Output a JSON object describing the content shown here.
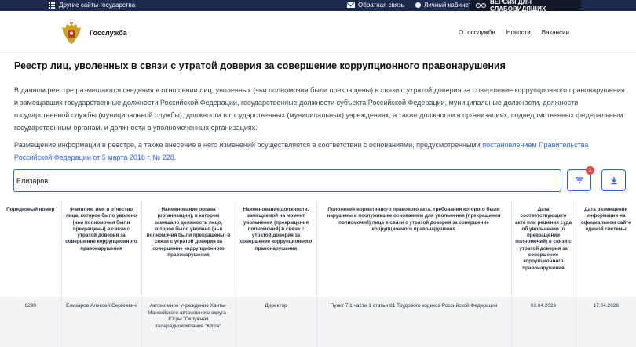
{
  "topbar": {
    "other_sites": "Другие сайты государства",
    "feedback": "Обратная связь",
    "cabinet": "Личный кабинет",
    "vision": "ВЕРСИЯ ДЛЯ СЛАБОВИДЯЩИХ"
  },
  "header": {
    "brand": "Госслужба",
    "nav": [
      "О госслужбе",
      "Новости",
      "Вакансии"
    ]
  },
  "page": {
    "title": "Реестр лиц, уволенных в связи с утратой доверия за совершение коррупционного правонарушения",
    "paragraph1": "В данном реестре размещаются сведения в отношении лиц, уволенных (чьи полномочия были прекращены) в связи с утратой доверия за совершение коррупционного правонарушения и замещавших государственные должности Российской Федерации, государственные должности субъекта Российской Федерации, муниципальные должности, должности государственной службы (муниципальной службы), должности в государственных (муниципальных) учреждениях, а также должности в организациях, подведомственных федеральным государственным органам, и должности в уполномоченных организациях.",
    "paragraph2_text": "Размещение информации в реестре, а также внесение в него изменений осуществляется в соответствии с основаниями, предусмотренными ",
    "paragraph2_link": "постановлением Правительства Российской Федерации от 5 марта 2018 г. № 228",
    "paragraph2_end": "."
  },
  "search": {
    "value": "Елизаров",
    "filter_badge": "1"
  },
  "table": {
    "headers": [
      "Порядковый номер",
      "Фамилия, имя и отчество лица, которое было уволено (чьи полномочия были прекращены) в связи с утратой доверия за совершение коррупционного правонарушения",
      "Наименование органа (организации), в котором замещало должность лицо, которое было уволено (чьи полномочия были прекращены) в связи с утратой доверия за совершение коррупционного правонарушения",
      "Наименование должности, замещаемой на момент увольнения (прекращения полномочий) в связи с утратой доверия за совершение коррупционного правонарушения",
      "Положение нормативного правового акта, требования которого были нарушены и послужившее основанием для увольнения (прекращения полномочий) лица в связи с утратой доверия за совершение коррупционного правонарушения",
      "Дата соответствующего акта или решения суда об увольнении (о прекращении полномочий) в связи с утратой доверия за совершение коррупционного правонарушения",
      "Дата размещения информации на официальном сайте единой системы"
    ],
    "rows": [
      {
        "number": "6290",
        "name": "Елизаров Алексей Сергеевич",
        "organization": "Автономное учреждение Ханты-Мансийского автономного округа - Югры \"Окружная телерадиокомпания \"Югра\"",
        "position": "Директор",
        "provision": "Пункт 7.1 части 1 статьи 81 Трудового кодекса Российской Федерации",
        "act_date": "03.04.2026",
        "posted_date": "17.04.2026"
      }
    ]
  }
}
